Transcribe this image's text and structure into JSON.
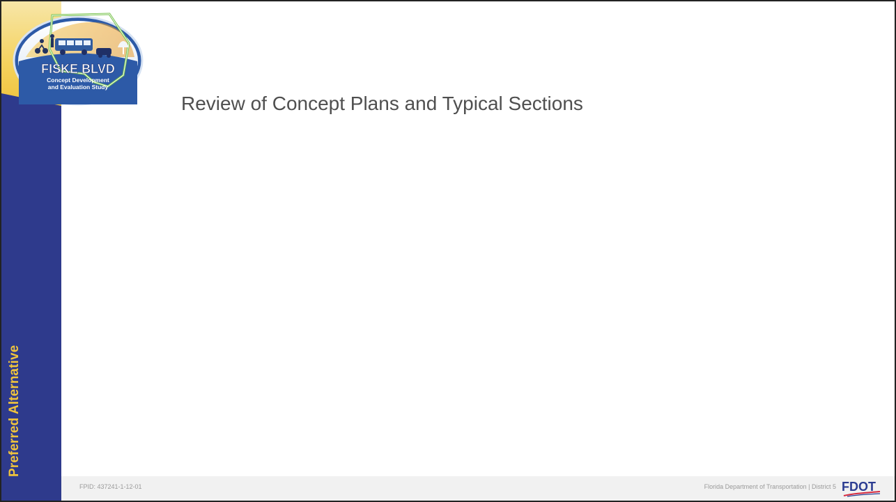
{
  "logo": {
    "title": "FISKE BLVD",
    "subtitle_line1": "Concept Development",
    "subtitle_line2": "and Evaluation Study"
  },
  "sidebar": {
    "vertical_title": "Preferred Alternative"
  },
  "slide": {
    "title": "Review of Concept Plans and Typical Sections"
  },
  "footer": {
    "fpid": "FPID: 437241-1-12-01",
    "department": "Florida Department of Transportation | District 5",
    "fdot_logo_text": "FDOT"
  },
  "colors": {
    "sidebar_blue": "#2e3a8c",
    "accent_yellow": "#f0c43c",
    "footer_bg": "#f1f1f1",
    "fdot_red": "#d6283d"
  }
}
